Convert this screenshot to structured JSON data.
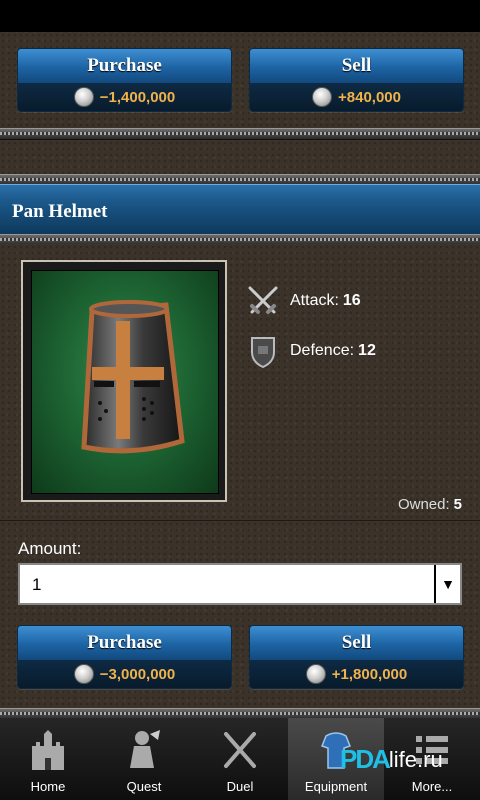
{
  "top_section": {
    "purchase": {
      "label": "Purchase",
      "price": "−1,400,000"
    },
    "sell": {
      "label": "Sell",
      "price": "+840,000"
    }
  },
  "item": {
    "name": "Pan Helmet",
    "icon": "helmet-icon",
    "stats": [
      {
        "icon": "crossed-swords-icon",
        "label": "Attack:",
        "value": "16"
      },
      {
        "icon": "shield-icon",
        "label": "Defence:",
        "value": "12"
      }
    ],
    "owned_label": "Owned:",
    "owned_value": "5"
  },
  "amount": {
    "label": "Amount:",
    "selected": "1"
  },
  "bottom_section": {
    "purchase": {
      "label": "Purchase",
      "price": "−3,000,000"
    },
    "sell": {
      "label": "Sell",
      "price": "+1,800,000"
    }
  },
  "tabbar": {
    "tabs": [
      {
        "label": "Home",
        "icon": "castle-icon"
      },
      {
        "label": "Quest",
        "icon": "knight-icon"
      },
      {
        "label": "Duel",
        "icon": "crossed-swords-icon"
      },
      {
        "label": "Equipment",
        "icon": "armor-icon"
      },
      {
        "label": "More...",
        "icon": "list-icon"
      }
    ]
  },
  "watermark": {
    "logo": "PDA",
    "text": "life.ru"
  },
  "colors": {
    "button_blue": "#1d63a3",
    "price_gold": "#f0b24a",
    "felt_green": "#1b5e2f"
  }
}
